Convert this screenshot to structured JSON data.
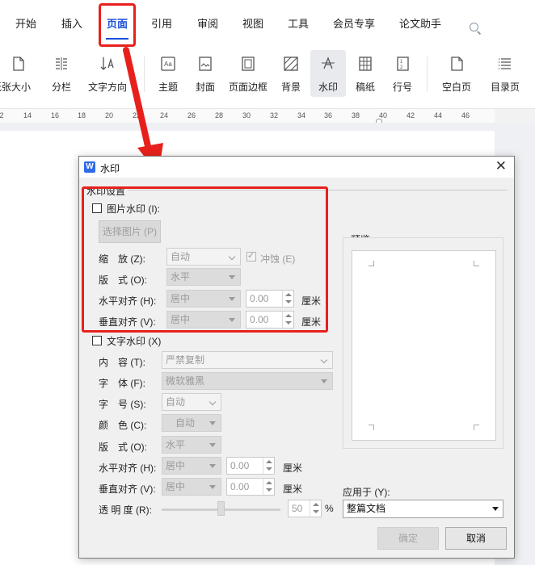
{
  "menu": {
    "items": [
      "开始",
      "插入",
      "页面",
      "引用",
      "审阅",
      "视图",
      "工具",
      "会员专享",
      "论文助手"
    ],
    "active": "页面"
  },
  "ribbon": {
    "items": [
      "纸张大小",
      "分栏",
      "文字方向",
      "主题",
      "封面",
      "页面边框",
      "背景",
      "水印",
      "稿纸",
      "行号",
      "空白页",
      "目录页"
    ],
    "active": "水印"
  },
  "ruler": {
    "ticks": [
      "2",
      "14",
      "16",
      "18",
      "20",
      "22",
      "24",
      "26",
      "28",
      "30",
      "32",
      "34",
      "36",
      "38",
      "40",
      "42",
      "44",
      "46"
    ]
  },
  "dialog": {
    "title": "水印",
    "close_glyph": "✕",
    "group_label": "水印设置",
    "picture": {
      "checkbox_label": "图片水印 (I):",
      "choose_button": "选择图片 (P)",
      "scale_label": "缩　放 (Z):",
      "scale_value": "自动",
      "washout_label": "冲蚀 (E)",
      "layout_label": "版　式 (O):",
      "layout_value": "水平",
      "halign_label": "水平对齐 (H):",
      "halign_value": "居中",
      "halign_offset": "0.00",
      "valign_label": "垂直对齐 (V):",
      "valign_value": "居中",
      "valign_offset": "0.00",
      "unit": "厘米"
    },
    "text": {
      "checkbox_label": "文字水印 (X)",
      "content_label": "内　容 (T):",
      "content_value": "严禁复制",
      "font_label": "字　体 (F):",
      "font_value": "微软雅黑",
      "size_label": "字　号 (S):",
      "size_value": "自动",
      "color_label": "颜　色 (C):",
      "color_value": "自动",
      "layout_label": "版　式 (O):",
      "layout_value": "水平",
      "halign_label": "水平对齐 (H):",
      "halign_value": "居中",
      "halign_offset": "0.00",
      "valign_label": "垂直对齐 (V):",
      "valign_value": "居中",
      "valign_offset": "0.00",
      "unit": "厘米",
      "transparency_label": "透 明 度 (R):",
      "transparency_value": "50",
      "transparency_unit": "%",
      "transparency_level": 0.5
    },
    "preview_label": "预览",
    "apply_label": "应用于 (Y):",
    "apply_value": "整篇文档",
    "ok_label": "确定",
    "cancel_label": "取消"
  },
  "colors": {
    "accent": "#1a4fd6",
    "annotation_red": "#e8201c",
    "brand_blue": "#2f6be8"
  }
}
